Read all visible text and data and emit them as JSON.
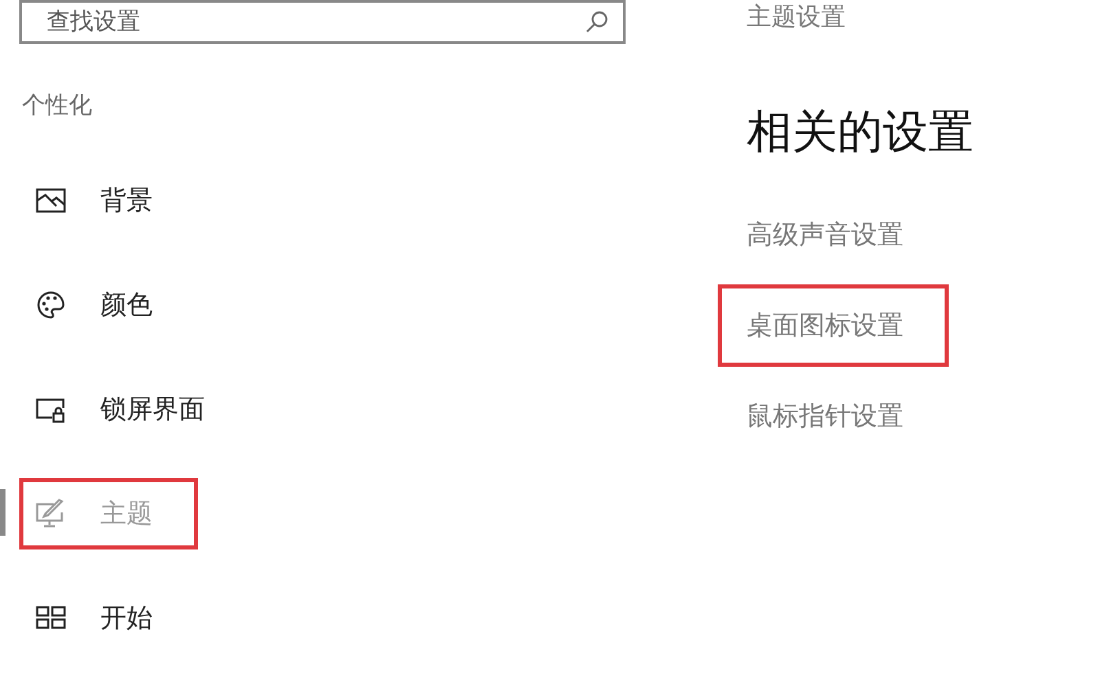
{
  "search": {
    "placeholder": "查找设置"
  },
  "section_title": "个性化",
  "nav_items": [
    {
      "label": "背景",
      "kind": "picture",
      "selected": false,
      "highlighted": false
    },
    {
      "label": "颜色",
      "kind": "palette",
      "selected": false,
      "highlighted": false
    },
    {
      "label": "锁屏界面",
      "kind": "lockscreen",
      "selected": false,
      "highlighted": false
    },
    {
      "label": "主题",
      "kind": "theme",
      "selected": true,
      "highlighted": true
    },
    {
      "label": "开始",
      "kind": "start",
      "selected": false,
      "highlighted": false
    }
  ],
  "top_link": "主题设置",
  "related": {
    "title": "相关的设置",
    "links": [
      {
        "label": "高级声音设置",
        "highlighted": false
      },
      {
        "label": "桌面图标设置",
        "highlighted": true
      },
      {
        "label": "鼠标指针设置",
        "highlighted": false
      }
    ]
  }
}
